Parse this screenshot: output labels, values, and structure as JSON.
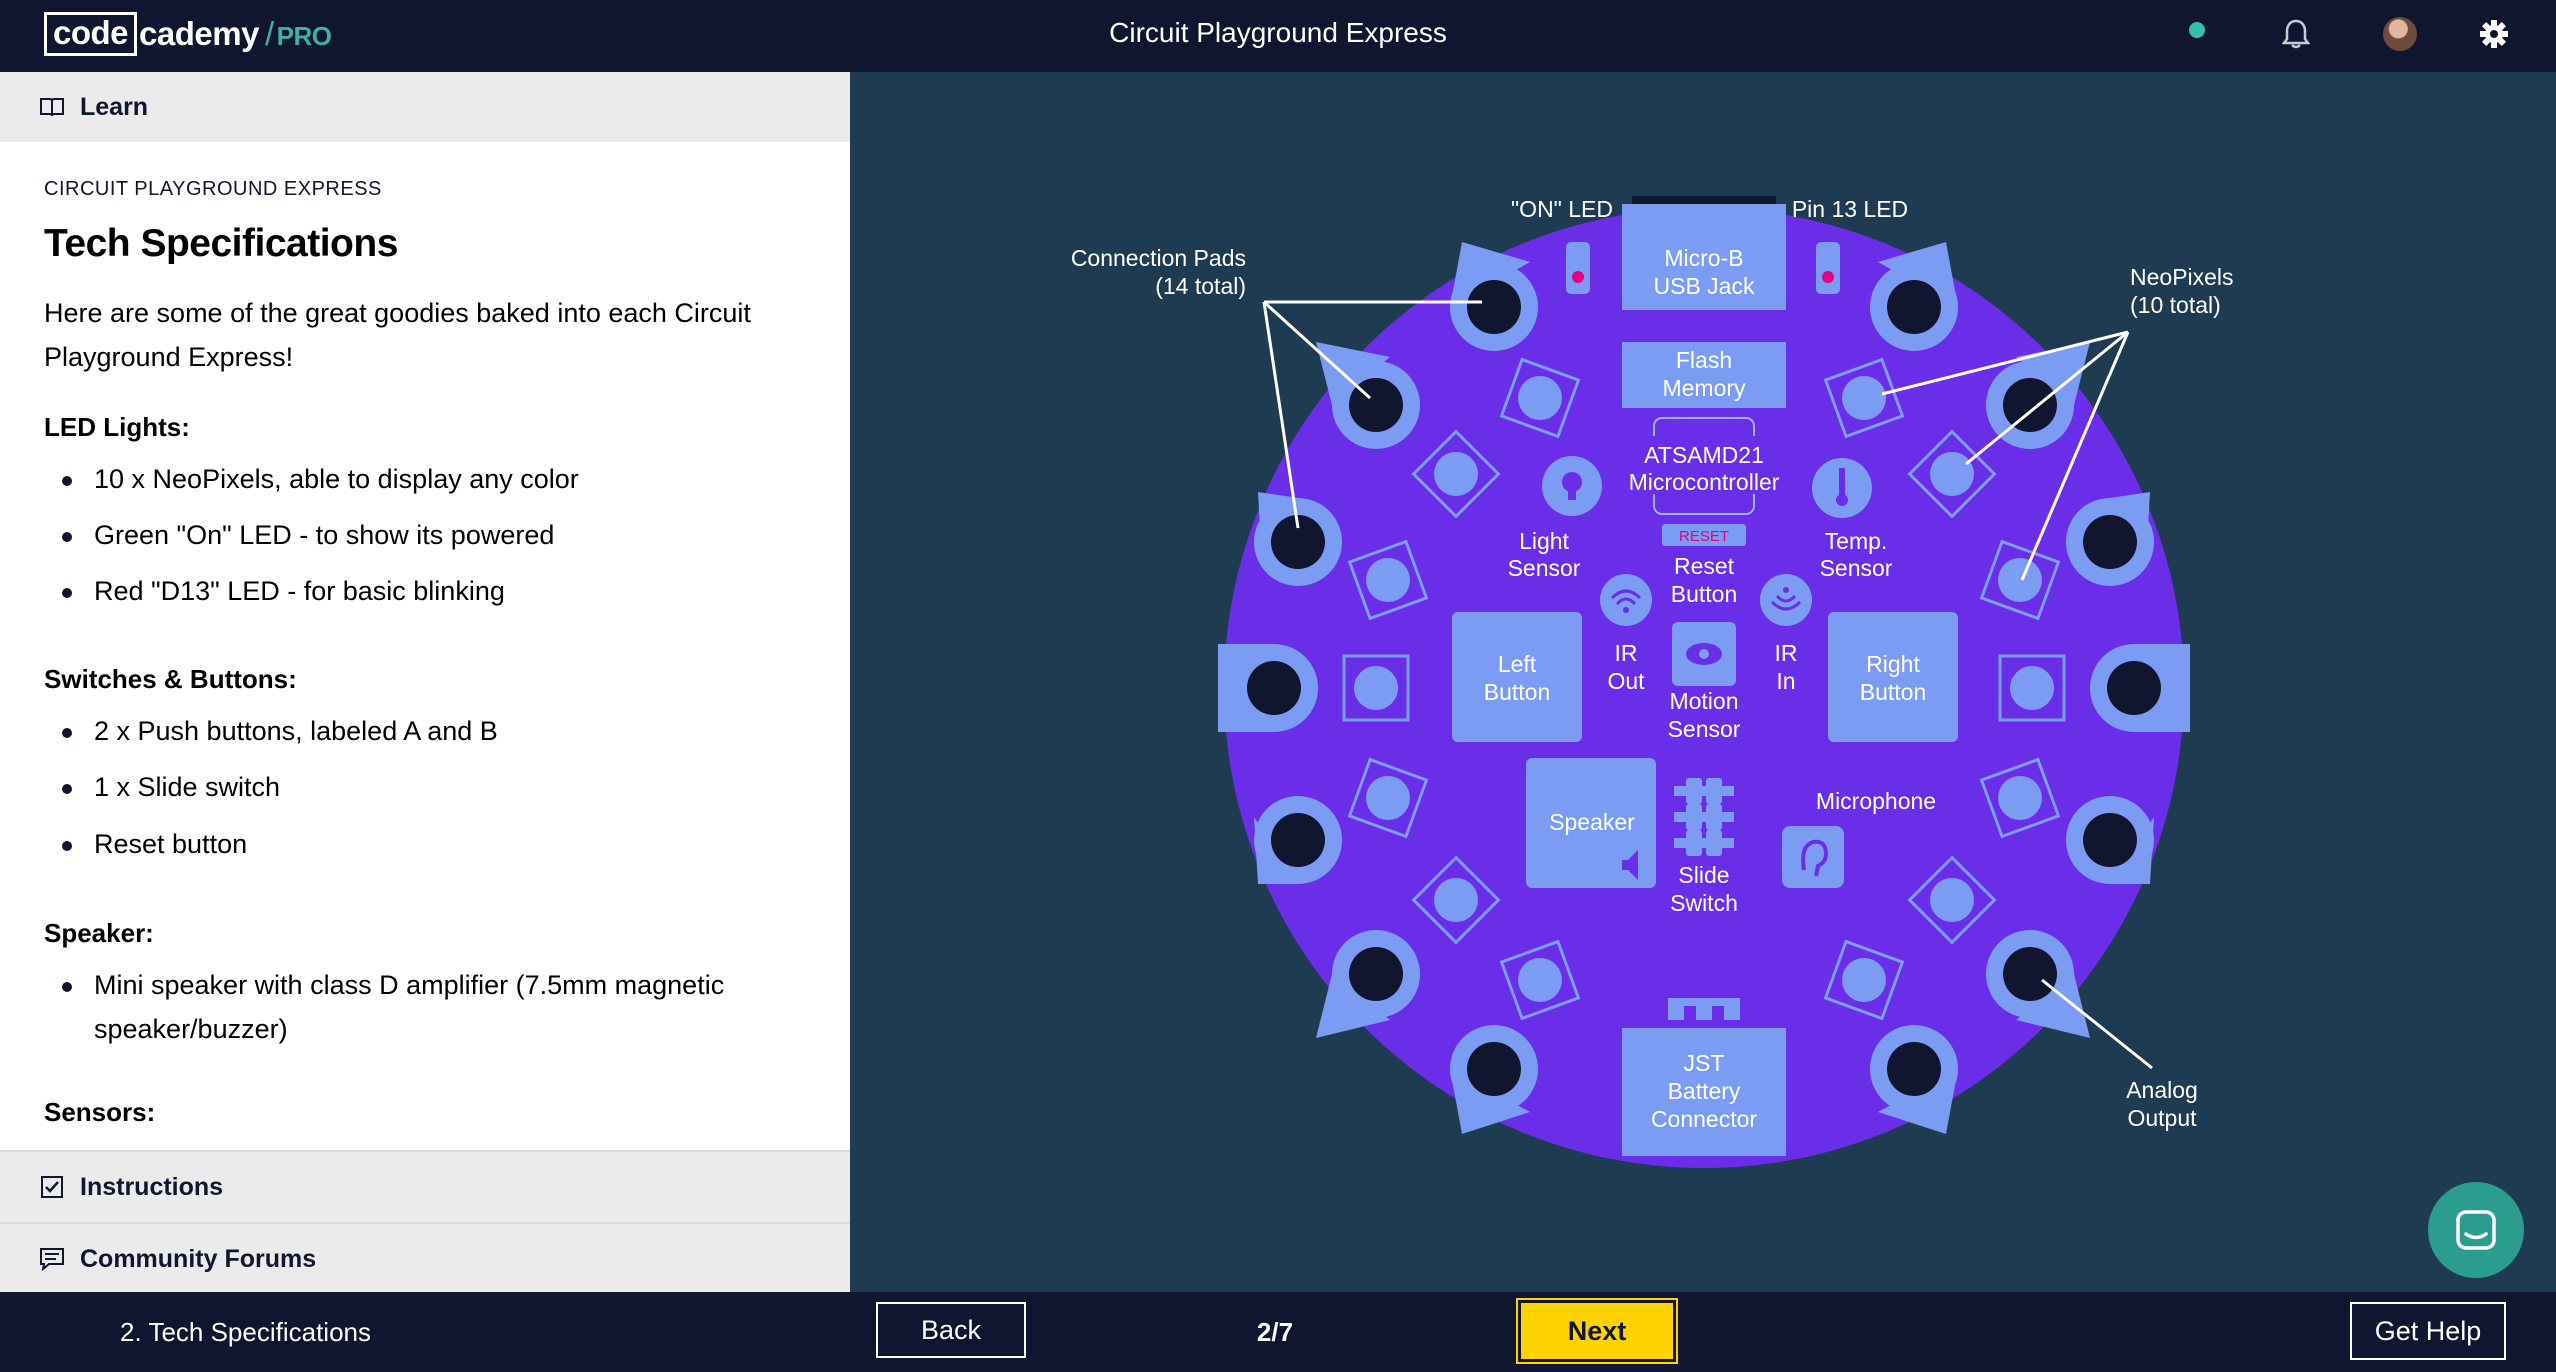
{
  "header": {
    "logo_code": "code",
    "logo_academy": "cademy",
    "logo_pro": "PRO",
    "title": "Circuit Playground Express",
    "status_color": "#33c1ab"
  },
  "sidebar": {
    "learn_label": "Learn",
    "eyebrow": "CIRCUIT PLAYGROUND EXPRESS",
    "title": "Tech Specifications",
    "intro": "Here are some of the great goodies baked into each Circuit Playground Express!",
    "sections": [
      {
        "heading": "LED Lights:",
        "items": [
          "10 x NeoPixels, able to display any color",
          "Green \"On\" LED - to show its powered",
          "Red \"D13\" LED - for basic blinking"
        ]
      },
      {
        "heading": "Switches & Buttons:",
        "items": [
          "2 x Push buttons, labeled A and B",
          "1 x Slide switch",
          "Reset button"
        ]
      },
      {
        "heading": "Speaker:",
        "items": [
          "Mini speaker with class D amplifier (7.5mm magnetic speaker/buzzer)"
        ]
      },
      {
        "heading": "Sensors:",
        "items": []
      }
    ],
    "instructions_label": "Instructions",
    "forums_label": "Community Forums"
  },
  "diagram": {
    "board_color": "#6a2ee8",
    "pad_color": "#7b9cf2",
    "labels": {
      "on_led": "\"ON\" LED",
      "pin13": "Pin 13 LED",
      "connection_pads_1": "Connection Pads",
      "connection_pads_2": "(14 total)",
      "neopixels_1": "NeoPixels",
      "neopixels_2": "(10 total)",
      "usb_1": "Micro-B",
      "usb_2": "USB Jack",
      "flash_1": "Flash",
      "flash_2": "Memory",
      "mcu_1": "ATSAMD21",
      "mcu_2": "Microcontroller",
      "light_1": "Light",
      "light_2": "Sensor",
      "temp_1": "Temp.",
      "temp_2": "Sensor",
      "reset_chip": "RESET",
      "reset_1": "Reset",
      "reset_2": "Button",
      "ir_out_1": "IR",
      "ir_out_2": "Out",
      "ir_in_1": "IR",
      "ir_in_2": "In",
      "left_1": "Left",
      "left_2": "Button",
      "right_1": "Right",
      "right_2": "Button",
      "motion_1": "Motion",
      "motion_2": "Sensor",
      "speaker": "Speaker",
      "slide_1": "Slide",
      "slide_2": "Switch",
      "microphone": "Microphone",
      "jst_1": "JST",
      "jst_2": "Battery",
      "jst_3": "Connector",
      "analog_1": "Analog",
      "analog_2": "Output"
    }
  },
  "footer": {
    "lesson_label": "2. Tech Specifications",
    "back_label": "Back",
    "progress": "2/7",
    "next_label": "Next",
    "help_label": "Get Help",
    "next_color": "#ffd300"
  }
}
